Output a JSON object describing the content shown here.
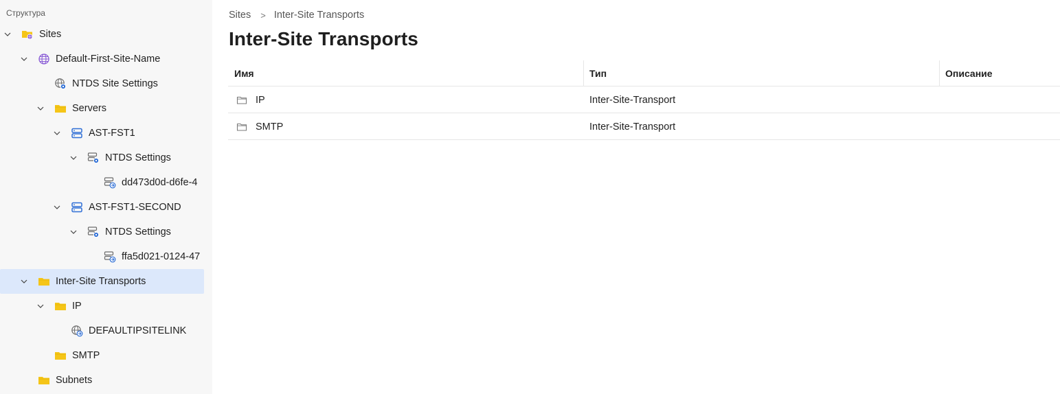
{
  "sidebar": {
    "title": "Структура",
    "items": [
      {
        "label": "Sites",
        "icon": "sites-folder-icon",
        "expanded": true
      },
      {
        "label": "Default-First-Site-Name",
        "icon": "globe-icon",
        "expanded": true
      },
      {
        "label": "NTDS Site Settings",
        "icon": "site-settings-icon"
      },
      {
        "label": "Servers",
        "icon": "folder-icon",
        "expanded": true
      },
      {
        "label": "AST-FST1",
        "icon": "server-icon",
        "expanded": true
      },
      {
        "label": "NTDS Settings",
        "icon": "ntds-settings-icon",
        "expanded": true
      },
      {
        "label": "dd473d0d-d6fe-4",
        "icon": "connection-icon"
      },
      {
        "label": "AST-FST1-SECOND",
        "icon": "server-icon",
        "expanded": true
      },
      {
        "label": "NTDS Settings",
        "icon": "ntds-settings-icon",
        "expanded": true
      },
      {
        "label": "ffa5d021-0124-47",
        "icon": "connection-icon"
      },
      {
        "label": "Inter-Site Transports",
        "icon": "folder-icon",
        "expanded": true,
        "selected": true
      },
      {
        "label": "IP",
        "icon": "folder-icon",
        "expanded": true
      },
      {
        "label": "DEFAULTIPSITELINK",
        "icon": "site-link-icon"
      },
      {
        "label": "SMTP",
        "icon": "folder-icon"
      },
      {
        "label": "Subnets",
        "icon": "folder-icon"
      }
    ]
  },
  "breadcrumb": {
    "root": "Sites",
    "separator": ">",
    "current": "Inter-Site Transports"
  },
  "page_title": "Inter-Site Transports",
  "table": {
    "columns": [
      "Имя",
      "Тип",
      "Описание"
    ],
    "rows": [
      {
        "name": "IP",
        "type": "Inter-Site-Transport",
        "description": ""
      },
      {
        "name": "SMTP",
        "type": "Inter-Site-Transport",
        "description": ""
      }
    ]
  },
  "colors": {
    "folder": "#f5c518",
    "selected_row": "#dce8fb",
    "server_blue": "#2f6fd6",
    "globe_purple": "#8a5cd6",
    "sidebar_bg": "#f7f7f7"
  }
}
